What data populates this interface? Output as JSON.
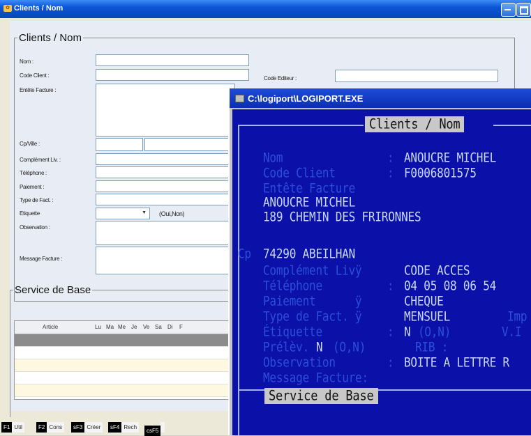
{
  "window": {
    "title": "Clients / Nom"
  },
  "form": {
    "group_title": "Clients / Nom",
    "labels": {
      "nom": "Nom :",
      "code_client": "Code Client :",
      "entete": "Entête Facture :",
      "cp_ville": "Cp/Ville :",
      "complement": "Complément Liv. :",
      "telephone": "Téléphone :",
      "paiement": "Paiement :",
      "type_fact": "Type de Fact. :",
      "etiquette": "Etiquette",
      "observation": "Observation :",
      "message": "Message Facture :",
      "code_editeur": "Code Editeur :"
    },
    "etiquette_hint": "(Oui,Non)",
    "service_title": "Service de Base",
    "grid_headers": [
      "Article",
      "Lu",
      "Ma",
      "Me",
      "Je",
      "Ve",
      "Sa",
      "Di",
      "F"
    ]
  },
  "fkeys": [
    {
      "key": "F1",
      "label": "Util"
    },
    {
      "key": "F2",
      "label": "Cons"
    },
    {
      "key": "sF3",
      "label": "Créer"
    },
    {
      "key": "sF4",
      "label": "Rech"
    },
    {
      "key": "csF5",
      "label": ""
    }
  ],
  "dos": {
    "title": "C:\\logiport\\LOGIPORT.EXE",
    "header": "Clients / Nom",
    "lines": {
      "nom_label": "Nom",
      "nom_value": "ANOUCRE MICHEL",
      "code_label": "Code Client",
      "code_value": "F0006801575",
      "entete_label": "Entête Facture",
      "entete_line1": "ANOUCRE MICHEL",
      "entete_line2": "189 CHEMIN DES FRIRONNES",
      "cp_label": "Cp",
      "cp_value": "74290 ABEILHAN",
      "compl_label": "Complément Livÿ",
      "compl_value": "CODE ACCES",
      "tel_label": "Téléphone",
      "tel_value": "04 05 08 06 54",
      "paie_label": "Paiement      ÿ",
      "paie_value": "CHEQUE",
      "type_label": "Type de Fact. ÿ",
      "type_value": "MENSUEL",
      "type_extra": "Imp",
      "etiq_label": "Étiquette",
      "etiq_value": "N",
      "etiq_hint": "(O,N)",
      "etiq_extra": "V.I",
      "prelev_label": "Prélèv.",
      "prelev_value": "N",
      "prelev_hint": "(O,N)",
      "rib_label": "RIB :",
      "obs_label": "Observation",
      "obs_value": "BOITE A LETTRE R",
      "msg_label": "Message Facture:",
      "service": "Service de Base"
    }
  }
}
